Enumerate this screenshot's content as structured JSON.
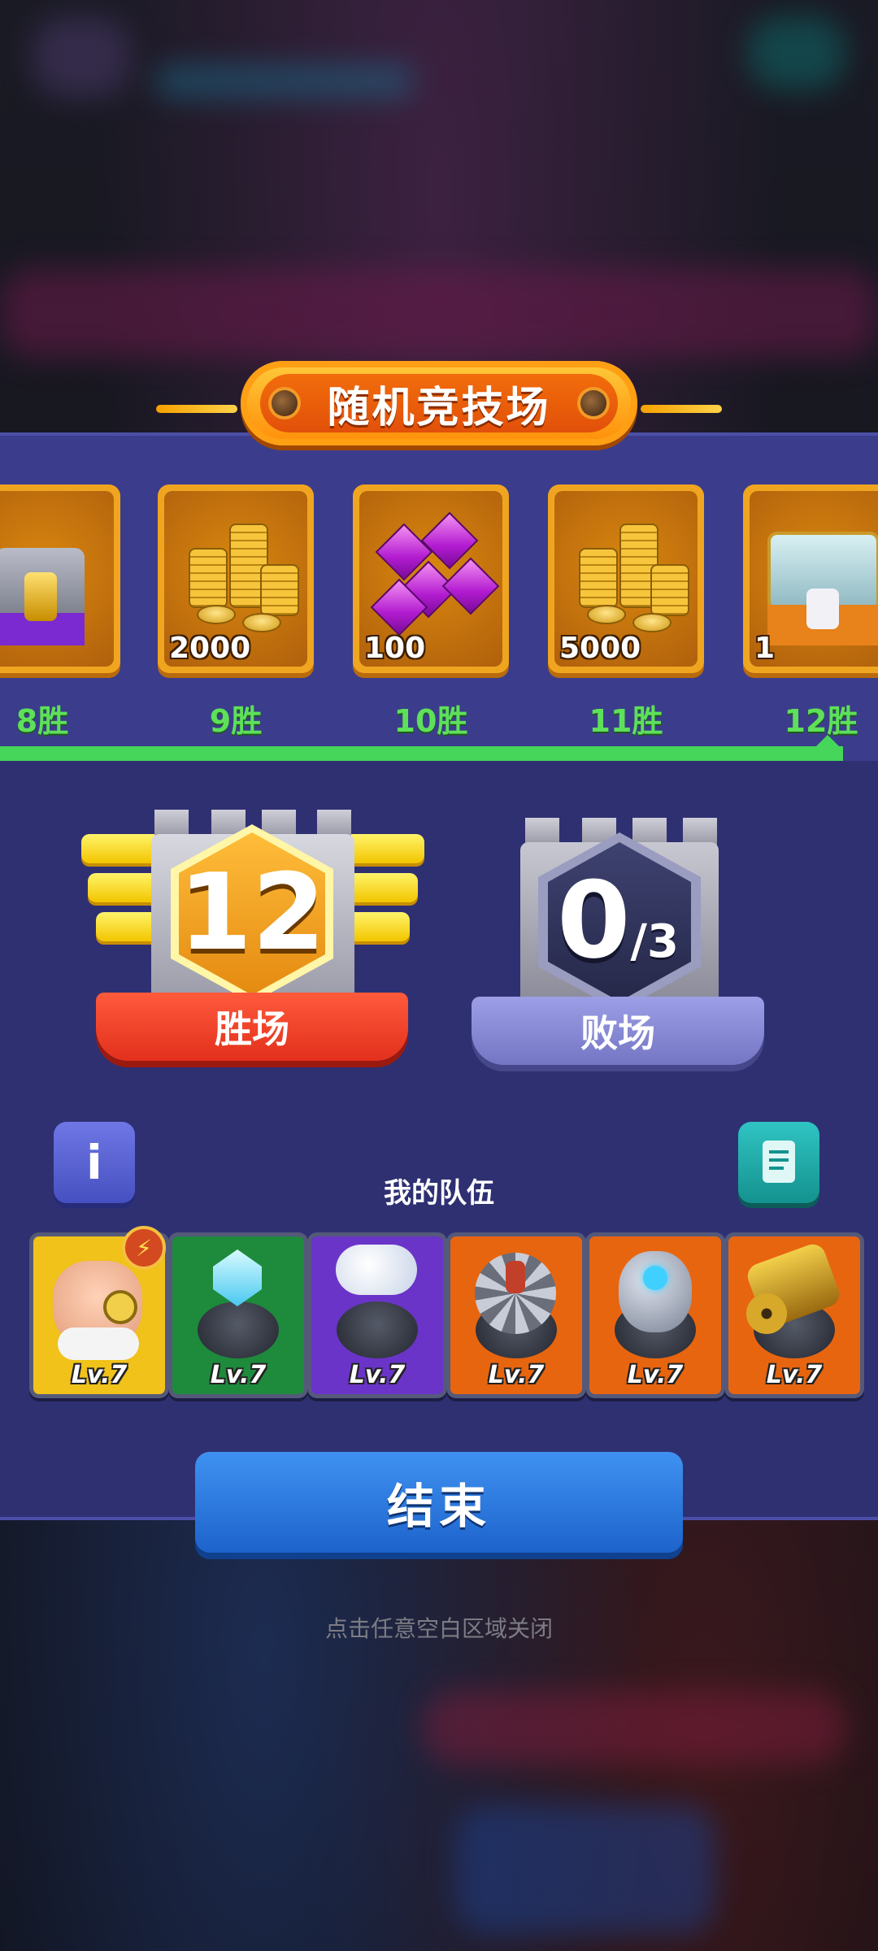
{
  "title": "随机竞技场",
  "rewards": [
    {
      "amount": "",
      "wins": "8胜",
      "kind": "chest-purple"
    },
    {
      "amount": "2000",
      "wins": "9胜",
      "kind": "coins"
    },
    {
      "amount": "100",
      "wins": "10胜",
      "kind": "gems"
    },
    {
      "amount": "5000",
      "wins": "11胜",
      "kind": "coins"
    },
    {
      "amount": "1",
      "wins": "12胜",
      "kind": "chest-gold"
    }
  ],
  "progress": 0.96,
  "wins": {
    "value": "12",
    "label": "胜场"
  },
  "losses": {
    "value": "0",
    "max": "/3",
    "label": "败场"
  },
  "team": {
    "title": "我的队伍",
    "units": [
      {
        "level": "Lv.7",
        "kind": "hero",
        "color": "#f0c21a"
      },
      {
        "level": "Lv.7",
        "kind": "crystal-tower",
        "color": "#1e8a3c"
      },
      {
        "level": "Lv.7",
        "kind": "cloud-tower",
        "color": "#6a34c8"
      },
      {
        "level": "Lv.7",
        "kind": "saw-tower",
        "color": "#e8650f"
      },
      {
        "level": "Lv.7",
        "kind": "orb-tower",
        "color": "#e8650f"
      },
      {
        "level": "Lv.7",
        "kind": "gatling-tower",
        "color": "#e8650f"
      }
    ]
  },
  "info_button": "i",
  "end_button": "结束",
  "hint": "点击任意空白区域关闭"
}
